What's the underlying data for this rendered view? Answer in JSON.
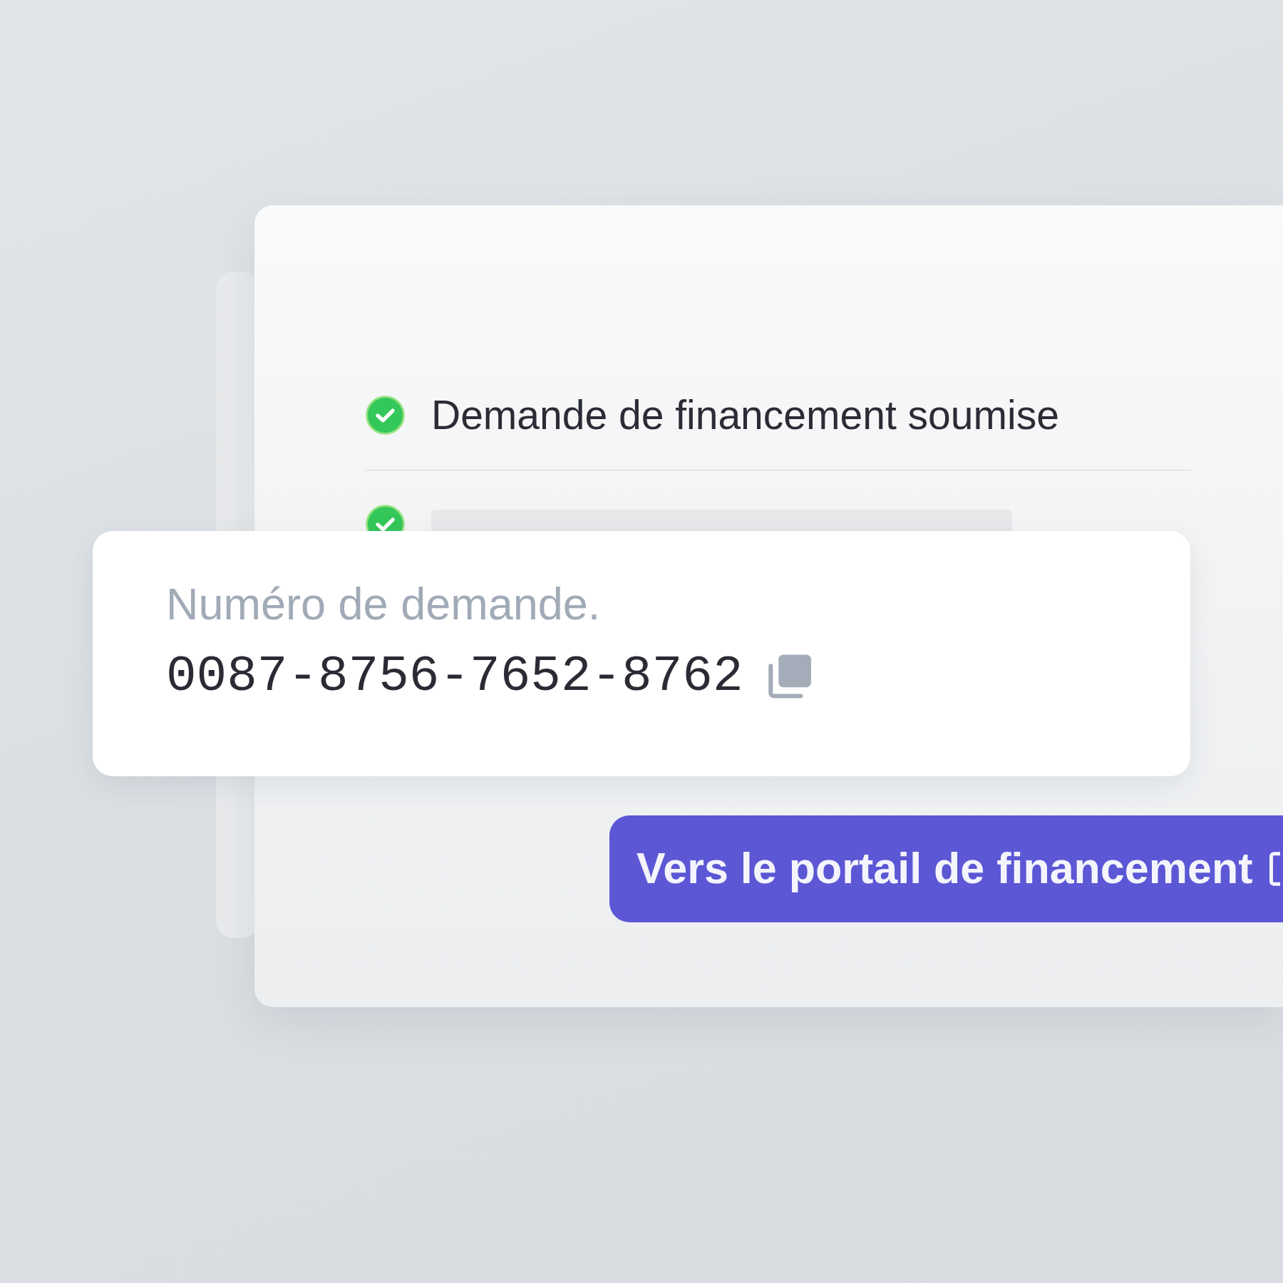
{
  "progress_card": {
    "steps": [
      {
        "kind": "text",
        "label": "Demande de financement soumise",
        "completed": true
      },
      {
        "kind": "skeleton",
        "completed": true
      }
    ]
  },
  "request_number_card": {
    "label": "Numéro de demande.",
    "value": "0087-8756-7652-8762"
  },
  "portal_button": {
    "label": "Vers le portail de financement"
  }
}
